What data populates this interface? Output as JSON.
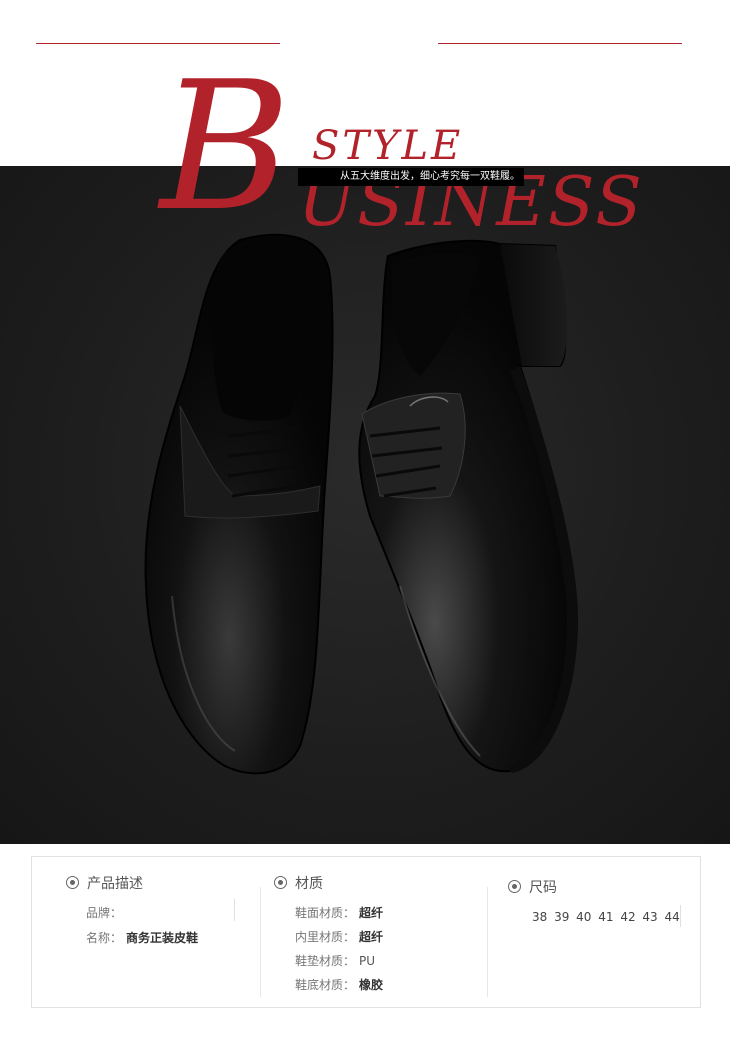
{
  "header": {
    "big_letter": "B",
    "style_word": "STYLE",
    "rest_word": "USINESS",
    "subtitle": "从五大维度出发，细心考究每一双鞋履。"
  },
  "colors": {
    "accent": "#b2222a",
    "background_dark": "#1e1e1e"
  },
  "info": {
    "description": {
      "title": "产品描述",
      "brand_label": "品牌：",
      "brand_value": "",
      "name_label": "名称：",
      "name_value": "商务正装皮鞋"
    },
    "material": {
      "title": "材质",
      "rows": [
        {
          "label": "鞋面材质：",
          "value": "超纤"
        },
        {
          "label": "内里材质：",
          "value": "超纤"
        },
        {
          "label": "鞋垫材质：",
          "value": "PU"
        },
        {
          "label": "鞋底材质：",
          "value": "橡胶"
        }
      ]
    },
    "size": {
      "title": "尺码",
      "values": "38 39 40 41 42 43 44"
    }
  }
}
